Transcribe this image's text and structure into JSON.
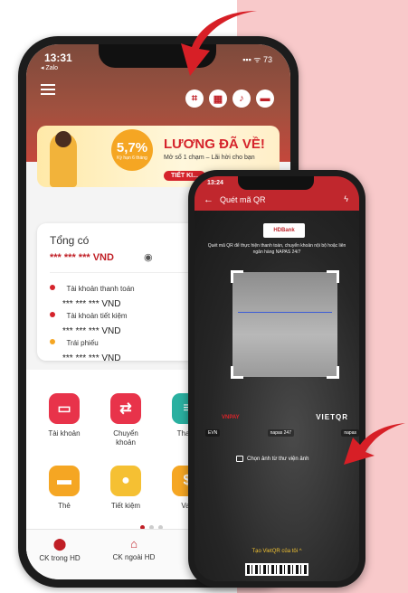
{
  "colors": {
    "brand_red": "#c0272d",
    "accent_orange": "#f5a623",
    "arrow_red": "#d71f26",
    "background_pink": "#f8c9ca"
  },
  "phone_home": {
    "status_time": "13:31",
    "back_app": "◂ Zalo",
    "status_right": "▪▪▪ ᯤ 73",
    "header_icons": [
      "qr-scan-icon",
      "grid-icon",
      "notification-icon",
      "chat-icon"
    ],
    "banner": {
      "rate": "5,7%",
      "rate_term": "Kỳ hạn 6 tháng",
      "headline": "LƯƠNG ĐÃ VỀ!",
      "subtitle": "Mở số 1 chạm – Lãi hời cho bạn",
      "cta": "TIẾT KI..."
    },
    "total_title": "Tổng có",
    "total_amount": "*** *** *** VND",
    "accounts": [
      {
        "label": "Tài khoản thanh toán",
        "amount": "*** *** *** VND",
        "color": "#d5232b"
      },
      {
        "label": "Tài khoản tiết kiệm",
        "amount": "*** *** *** VND",
        "color": "#d5232b"
      },
      {
        "label": "Trái phiếu",
        "amount": "*** *** *** VND",
        "color": "#f5a623"
      }
    ],
    "services": [
      {
        "label": "Tài khoản",
        "icon": "wallet-icon",
        "color": "#e8334a"
      },
      {
        "label": "Chuyển khoản",
        "icon": "transfer-icon",
        "color": "#e8334a"
      },
      {
        "label": "Thanh",
        "icon": "bill-icon",
        "color": "#2ab0a0"
      },
      {
        "label": "Thẻ",
        "icon": "card-icon",
        "color": "#f5a623"
      },
      {
        "label": "Tiết kiệm",
        "icon": "piggy-bank-icon",
        "color": "#f5c033"
      },
      {
        "label": "Vay",
        "icon": "loan-icon",
        "color": "#f5a623"
      }
    ],
    "tabs": [
      {
        "label": "CK trong HD",
        "icon": "transfer-in-icon"
      },
      {
        "label": "CK ngoài HD",
        "icon": "bank-icon"
      },
      {
        "label": "CK qu",
        "icon": "transfer-out-icon"
      }
    ]
  },
  "phone_scan": {
    "status_time": "13:24",
    "title": "Quét mã QR",
    "bank_logo": "HDBank",
    "note": "Quét mã QR để thực hiện thanh toán, chuyển khoản nội bộ hoặc liên ngân hàng NAPAS 24/7",
    "brand_left": "VNPAY",
    "brand_right": "VIETQR",
    "partners": [
      "EVN",
      "napas 247",
      "napas"
    ],
    "pick_image": "Chọn ảnh từ thư viện ảnh",
    "create_qr": "Tạo VietQR của tôi ^"
  }
}
